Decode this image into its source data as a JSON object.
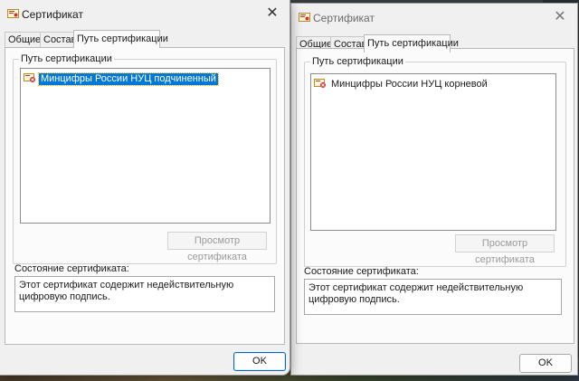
{
  "left_window": {
    "title": "Сертификат",
    "tabs": [
      {
        "label": "Общие",
        "active": false
      },
      {
        "label": "Состав",
        "active": false
      },
      {
        "label": "Путь сертификации",
        "active": true
      }
    ],
    "path_group_label": "Путь сертификации",
    "tree_item": "Минцифры России НУЦ подчиненный",
    "view_button": "Просмотр сертификата",
    "state_label": "Состояние сертификата:",
    "state_text": "Этот сертификат содержит недействительную цифровую подпись.",
    "ok": "OK"
  },
  "right_window": {
    "title": "Сертификат",
    "tabs": [
      {
        "label": "Общие",
        "active": false
      },
      {
        "label": "Состав",
        "active": false
      },
      {
        "label": "Путь сертификации",
        "active": true
      }
    ],
    "path_group_label": "Путь сертификации",
    "tree_item": "Минцифры России НУЦ корневой",
    "view_button": "Просмотр сертификата",
    "state_label": "Состояние сертификата:",
    "state_text": "Этот сертификат содержит недействительную цифровую подпись.",
    "ok": "OK"
  },
  "colors": {
    "selection": "#0078d7",
    "ok_border": "#0067c0",
    "window_bg": "#f0f0f0"
  },
  "icons": {
    "title": "certificate-icon",
    "tree": "certificate-error-icon",
    "close": "close-icon"
  }
}
